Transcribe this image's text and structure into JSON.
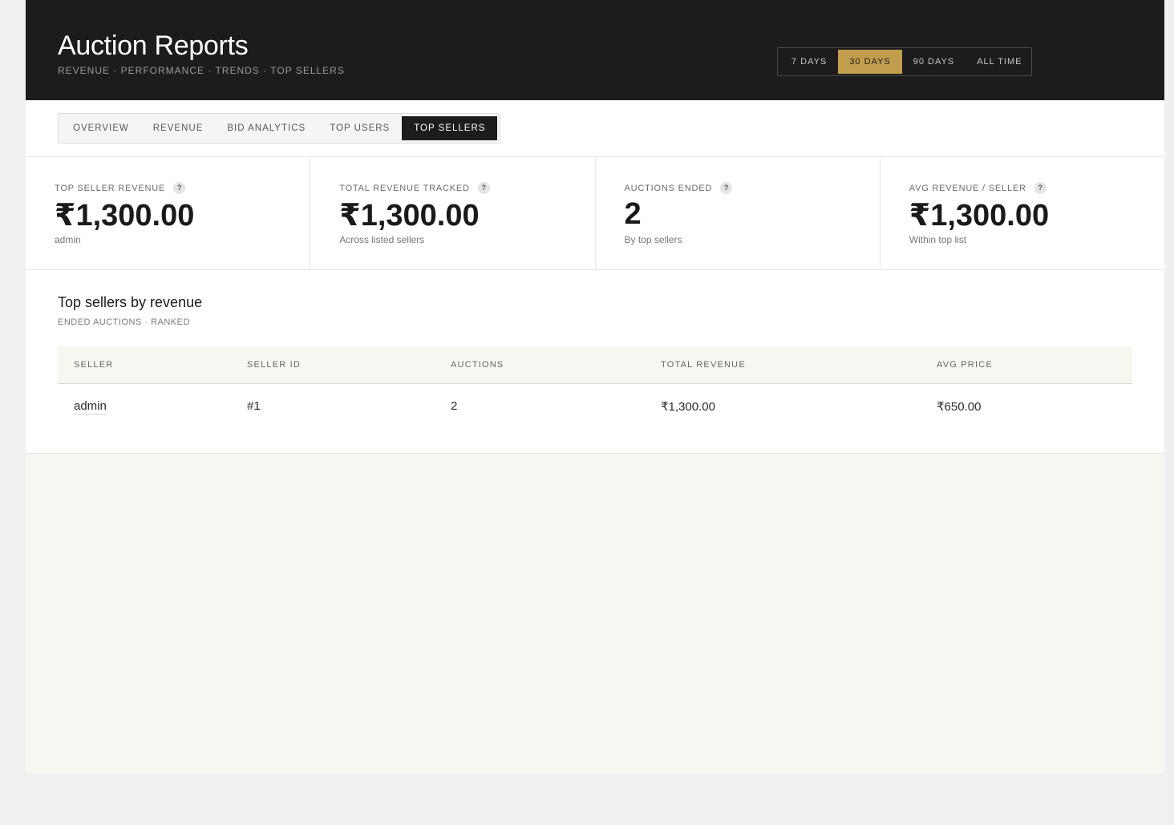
{
  "header": {
    "title": "Auction Reports",
    "subtitle": "REVENUE · PERFORMANCE · TRENDS · TOP SELLERS",
    "ranges": [
      {
        "label": "7 DAYS",
        "active": false
      },
      {
        "label": "30 DAYS",
        "active": true
      },
      {
        "label": "90 DAYS",
        "active": false
      },
      {
        "label": "ALL TIME",
        "active": false
      }
    ]
  },
  "tabs": [
    {
      "label": "OVERVIEW",
      "active": false
    },
    {
      "label": "REVENUE",
      "active": false
    },
    {
      "label": "BID ANALYTICS",
      "active": false
    },
    {
      "label": "TOP USERS",
      "active": false
    },
    {
      "label": "TOP SELLERS",
      "active": true
    }
  ],
  "stats": [
    {
      "label": "TOP SELLER REVENUE",
      "value": "₹1,300.00",
      "sub": "admin",
      "help": "?"
    },
    {
      "label": "TOTAL REVENUE TRACKED",
      "value": "₹1,300.00",
      "sub": "Across listed sellers",
      "help": "?"
    },
    {
      "label": "AUCTIONS ENDED",
      "value": "2",
      "sub": "By top sellers",
      "help": "?"
    },
    {
      "label": "AVG REVENUE / SELLER",
      "value": "₹1,300.00",
      "sub": "Within top list",
      "help": "?"
    }
  ],
  "section": {
    "title": "Top sellers by revenue",
    "subtitle": "ENDED AUCTIONS · RANKED",
    "columns": [
      "SELLER",
      "SELLER ID",
      "AUCTIONS",
      "TOTAL REVENUE",
      "AVG PRICE"
    ],
    "rows": [
      [
        "admin",
        "#1",
        "2",
        "₹1,300.00",
        "₹650.00"
      ]
    ]
  },
  "colors": {
    "header_bg": "#1c1c1c",
    "accent": "#c39d4e",
    "page_bg": "#f8f6f1"
  }
}
